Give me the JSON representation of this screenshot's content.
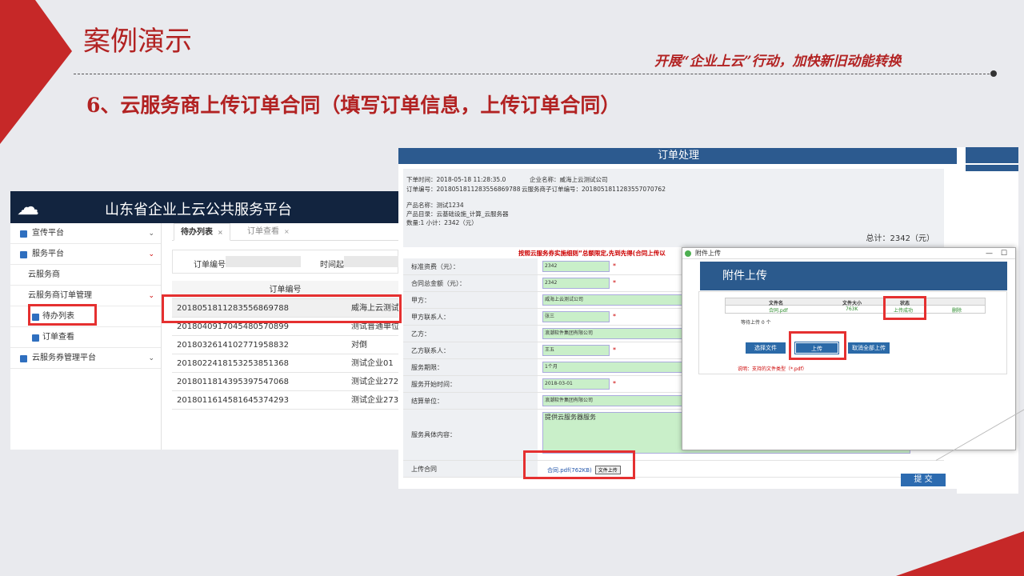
{
  "slide": {
    "title": "案例演示",
    "slogan": "开展“企业上云”行动，加快新旧动能转换",
    "step": "6、云服务商上传订单合同（填写订单信息，上传订单合同）"
  },
  "platform": {
    "title": "山东省企业上云公共服务平台",
    "menu": [
      {
        "label": "宣传平台",
        "chevron": "⌄"
      },
      {
        "label": "服务平台",
        "chevron": "⌄"
      },
      {
        "label": "云服务商"
      },
      {
        "label": "云服务商订单管理",
        "chevron": "⌄"
      },
      {
        "label": "待办列表"
      },
      {
        "label": "订单查看"
      },
      {
        "label": "云服务券管理平台",
        "chevron": "⌄"
      }
    ],
    "tabs": [
      "待办列表",
      "订单查看"
    ],
    "filter": {
      "order_no": "订单编号",
      "time_from": "时间起"
    },
    "table": {
      "header": "订单编号",
      "rows": [
        {
          "no": "2018051811283556869788",
          "company": "威海上云测试公"
        },
        {
          "no": "2018040917045480570899",
          "company": "测试普通单位"
        },
        {
          "no": "2018032614102771958832",
          "company": "对倒"
        },
        {
          "no": "2018022418153253851368",
          "company": "测试企业01"
        },
        {
          "no": "2018011814395397547068",
          "company": "测试企业272"
        },
        {
          "no": "2018011614581645374293",
          "company": "测试企业273"
        }
      ]
    }
  },
  "order": {
    "bar": "订单处理",
    "info": {
      "line1": "下单时间：2018-05-18 11:28:35.0",
      "line1b": "企业名称：威海上云测试公司",
      "line2": "订单编号：2018051811283556869788",
      "line2b": "云服务商子订单编号：2018051811283557070762",
      "line3": "产品名称：测试1234",
      "line4": "产品目录：云基础设施_计算_云服务器",
      "line5": "数量:1    小计：2342（元）",
      "total": "总计：2342（元）"
    },
    "notice": "按照云服务券实施细则“总额限定,先到先得(合同上传以",
    "fields": [
      {
        "label": "标准资费（元）：",
        "value": "2342",
        "req": "*"
      },
      {
        "label": "合同总金额（元）：",
        "value": "2342",
        "req": "*"
      },
      {
        "label": "甲方：",
        "value": "威海上云测试公司",
        "long": true
      },
      {
        "label": "甲方联系人：",
        "value": "张三",
        "req": "*"
      },
      {
        "label": "乙方：",
        "value": "浪潮软件集团有限公司",
        "long": true
      },
      {
        "label": "乙方联系人：",
        "value": "王五",
        "req": "*"
      },
      {
        "label": "服务期限：",
        "value": "1个月",
        "long": true
      },
      {
        "label": "服务开始时间：",
        "value": "2018-03-01",
        "req": "*"
      },
      {
        "label": "结算单位：",
        "value": "浪潮软件集团有限公司",
        "long": true
      }
    ],
    "content": {
      "label": "服务具体内容：",
      "value": "提供云服务器服务"
    },
    "upload": {
      "label": "上传合同",
      "file": "合同.pdf(762KB)",
      "btn": "文件上传"
    },
    "submit": "提 交"
  },
  "dialog": {
    "title": "附件上传",
    "header": "附件上传",
    "cols": [
      "文件名",
      "文件大小",
      "状态"
    ],
    "row": {
      "name": "合同.pdf",
      "size": "763K",
      "status": "上传成功",
      "del": "删除"
    },
    "wait": "等待上传 0 个",
    "buttons": [
      "选择文件",
      "上传",
      "取消全部上传"
    ],
    "note": "说明：支持的文件类型（*.pdf）"
  }
}
